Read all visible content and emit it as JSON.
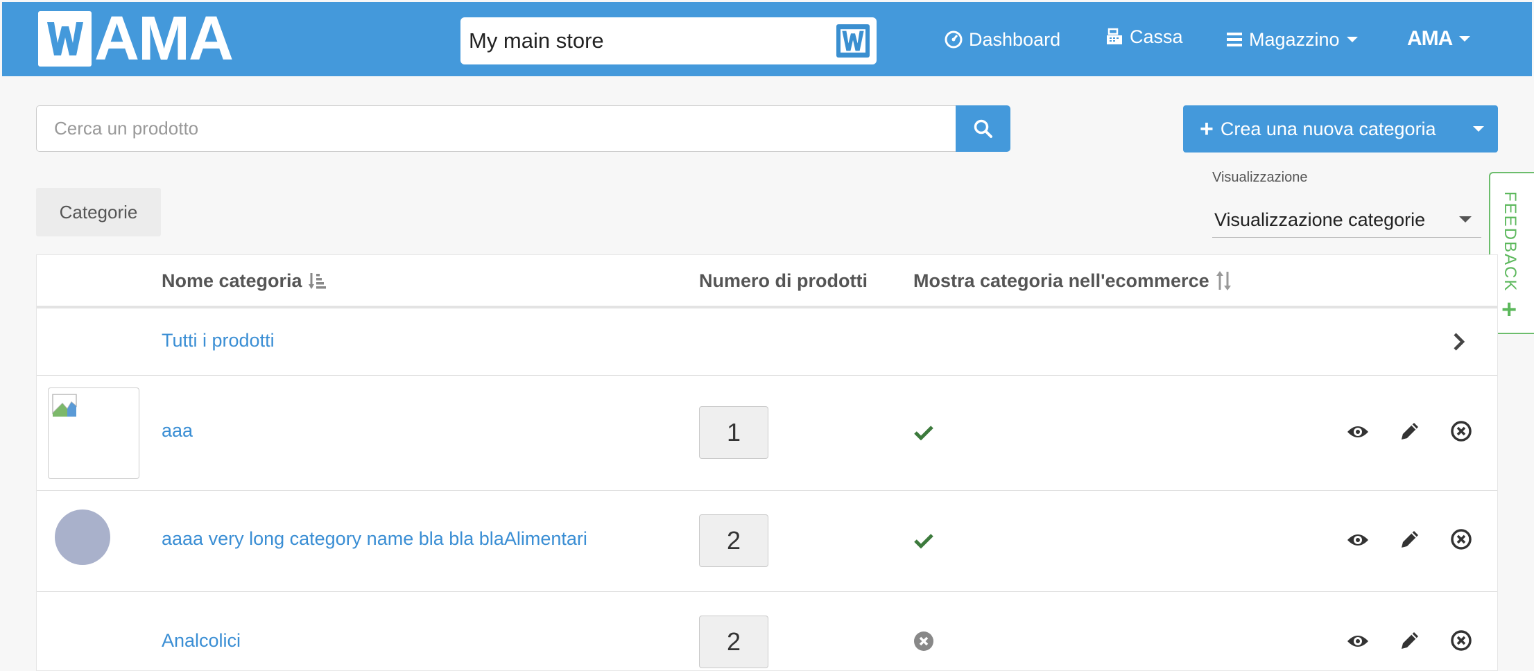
{
  "navbar": {
    "logo_text": "AMA",
    "store_name": "My main store",
    "dashboard_label": "Dashboard",
    "cassa_label": "Cassa",
    "magazzino_label": "Magazzino",
    "user_label": "AMA",
    "brand_color": "#4499db"
  },
  "search": {
    "placeholder": "Cerca un prodotto",
    "value": ""
  },
  "create_button": {
    "label": "Crea una nuova categoria"
  },
  "tab": {
    "label": "Categorie"
  },
  "view": {
    "label": "Visualizzazione",
    "selected": "Visualizzazione categorie"
  },
  "feedback": {
    "label": "FEEDBACK"
  },
  "table": {
    "headers": {
      "name": "Nome categoria",
      "count": "Numero di prodotti",
      "ecommerce": "Mostra categoria nell'ecommerce"
    },
    "all_products": "Tutti i prodotti",
    "rows": [
      {
        "name": "aaa",
        "count": "1",
        "visible": true,
        "image": "broken-image"
      },
      {
        "name": "aaaa very long category name bla bla blaAlimentari",
        "count": "2",
        "visible": true,
        "image": "avatar"
      },
      {
        "name": "Analcolici",
        "count": "2",
        "visible": false,
        "image": "none"
      }
    ]
  }
}
